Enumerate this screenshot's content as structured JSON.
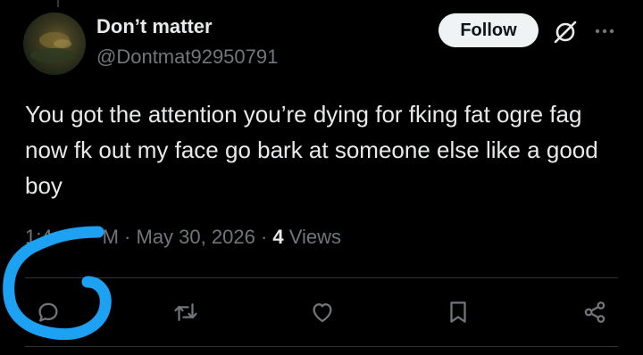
{
  "author": {
    "display_name": "Don’t matter",
    "handle": "@Dontmat92950791"
  },
  "header": {
    "follow_label": "Follow",
    "grok_icon": "grok-icon",
    "more_icon": "more-icon"
  },
  "tweet": {
    "text": "You got the attention you’re dying for fking fat ogre fag now fk out my face go bark at someone else like a good boy",
    "time_visible": "1:4",
    "time_suffix": "M",
    "date": "May 30, 2026",
    "separator": "·",
    "views_count": "4",
    "views_label": "Views"
  },
  "actions": [
    "reply-icon",
    "retweet-icon",
    "like-icon",
    "bookmark-icon",
    "share-icon"
  ],
  "colors": {
    "background": "#000000",
    "primary_text": "#e7e9ea",
    "secondary_text": "#71767b",
    "follow_button_bg": "#eff3f4",
    "annotation_scribble": "#1da1f2"
  }
}
